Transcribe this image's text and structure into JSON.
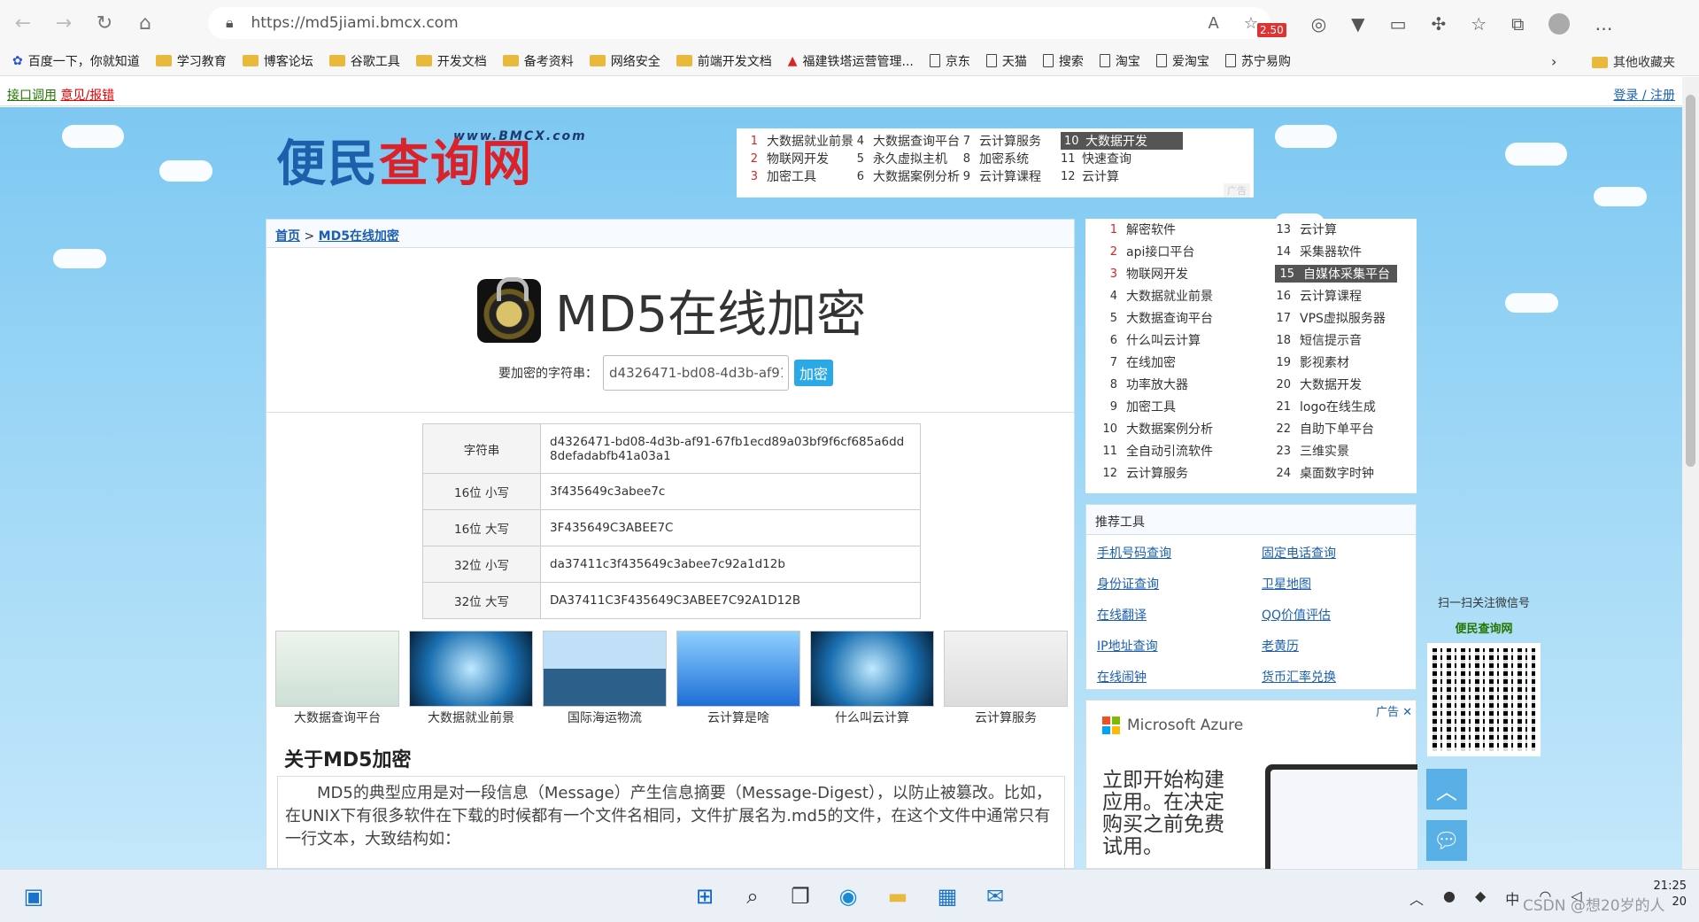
{
  "browser": {
    "url": "https://md5jiami.bmcx.com",
    "badge": "2.50"
  },
  "bookmarks": [
    {
      "label": "百度一下，你就知道",
      "type": "paw"
    },
    {
      "label": "学习教育",
      "type": "folder"
    },
    {
      "label": "博客论坛",
      "type": "folder"
    },
    {
      "label": "谷歌工具",
      "type": "folder"
    },
    {
      "label": "开发文档",
      "type": "folder"
    },
    {
      "label": "备考资料",
      "type": "folder"
    },
    {
      "label": "网络安全",
      "type": "folder"
    },
    {
      "label": "前端开发文档",
      "type": "folder"
    },
    {
      "label": "福建铁塔运营管理...",
      "type": "logo"
    },
    {
      "label": "京东",
      "type": "page"
    },
    {
      "label": "天猫",
      "type": "page"
    },
    {
      "label": "搜索",
      "type": "page"
    },
    {
      "label": "淘宝",
      "type": "page"
    },
    {
      "label": "爱淘宝",
      "type": "page"
    },
    {
      "label": "苏宁易购",
      "type": "page"
    }
  ],
  "bookmarks_other": "其他收藏夹",
  "sitebar": {
    "api": "接口调用",
    "feedback": "意见/报错",
    "login": "登录 / 注册"
  },
  "logo": {
    "main_a": "便民",
    "main_b": "查询网",
    "url": "www.BMCX.com"
  },
  "top_ads": [
    {
      "n": "1",
      "t": "大数据就业前景"
    },
    {
      "n": "2",
      "t": "物联网开发"
    },
    {
      "n": "3",
      "t": "加密工具"
    },
    {
      "n": "4",
      "t": "大数据查询平台"
    },
    {
      "n": "5",
      "t": "永久虚拟主机"
    },
    {
      "n": "6",
      "t": "大数据案例分析"
    },
    {
      "n": "7",
      "t": "云计算服务"
    },
    {
      "n": "8",
      "t": "加密系统"
    },
    {
      "n": "9",
      "t": "云计算课程"
    },
    {
      "n": "10",
      "t": "大数据开发"
    },
    {
      "n": "11",
      "t": "快速查询"
    },
    {
      "n": "12",
      "t": "云计算"
    }
  ],
  "ad_mark": "广告",
  "breadcrumb": {
    "home": "首页",
    "current": "MD5在线加密",
    "sep": ">"
  },
  "page_title": "MD5在线加密",
  "form": {
    "label": "要加密的字符串：",
    "value": "d4326471-bd08-4d3b-af91-67fb1ecd89a03bf9f6cf685a6dd8defadabfb41a03a1",
    "button": "加密"
  },
  "results": [
    {
      "k": "字符串",
      "v": "d4326471-bd08-4d3b-af91-67fb1ecd89a03bf9f6cf685a6dd8defadabfb41a03a1"
    },
    {
      "k": "16位 小写",
      "v": "3f435649c3abee7c"
    },
    {
      "k": "16位 大写",
      "v": "3F435649C3ABEE7C"
    },
    {
      "k": "32位 小写",
      "v": "da37411c3f435649c3abee7c92a1d12b"
    },
    {
      "k": "32位 大写",
      "v": "DA37411C3F435649C3ABEE7C92A1D12B"
    }
  ],
  "thumbs": [
    "大数据查询平台",
    "大数据就业前景",
    "国际海运物流",
    "云计算是啥",
    "什么叫云计算",
    "云计算服务"
  ],
  "about": {
    "heading": "关于MD5加密",
    "text": "MD5的典型应用是对一段信息（Message）产生信息摘要（Message-Digest），以防止被篡改。比如，在UNIX下有很多软件在下载的时候都有一个文件名相同，文件扩展名为.md5的文件，在这个文件中通常只有一行文本，大致结构如："
  },
  "side_ads": [
    {
      "n": "1",
      "t": "解密软件"
    },
    {
      "n": "2",
      "t": "api接口平台"
    },
    {
      "n": "3",
      "t": "物联网开发"
    },
    {
      "n": "4",
      "t": "大数据就业前景"
    },
    {
      "n": "5",
      "t": "大数据查询平台"
    },
    {
      "n": "6",
      "t": "什么叫云计算"
    },
    {
      "n": "7",
      "t": "在线加密"
    },
    {
      "n": "8",
      "t": "功率放大器"
    },
    {
      "n": "9",
      "t": "加密工具"
    },
    {
      "n": "10",
      "t": "大数据案例分析"
    },
    {
      "n": "11",
      "t": "全自动引流软件"
    },
    {
      "n": "12",
      "t": "云计算服务"
    },
    {
      "n": "13",
      "t": "云计算"
    },
    {
      "n": "14",
      "t": "采集器软件"
    },
    {
      "n": "15",
      "t": "自媒体采集平台"
    },
    {
      "n": "16",
      "t": "云计算课程"
    },
    {
      "n": "17",
      "t": "VPS虚拟服务器"
    },
    {
      "n": "18",
      "t": "短信提示音"
    },
    {
      "n": "19",
      "t": "影视素材"
    },
    {
      "n": "20",
      "t": "大数据开发"
    },
    {
      "n": "21",
      "t": "logo在线生成"
    },
    {
      "n": "22",
      "t": "自助下单平台"
    },
    {
      "n": "23",
      "t": "三维实景"
    },
    {
      "n": "24",
      "t": "桌面数字时钟"
    }
  ],
  "recommend": {
    "title": "推荐工具",
    "links": [
      "手机号码查询",
      "固定电话查询",
      "身份证查询",
      "卫星地图",
      "在线翻译",
      "QQ价值评估",
      "IP地址查询",
      "老黄历",
      "在线闹钟",
      "货币汇率兑换"
    ]
  },
  "azure": {
    "brand": "Microsoft Azure",
    "text": "立即开始构建应用。在决定购买之前免费试用。",
    "ad": "广告"
  },
  "qr": {
    "line1": "扫一扫关注微信号",
    "line2": "便民查询网"
  },
  "taskbar": {
    "time": "21:25",
    "date": "20",
    "ime": "中",
    "watermark": "CSDN @想20岁的人"
  }
}
